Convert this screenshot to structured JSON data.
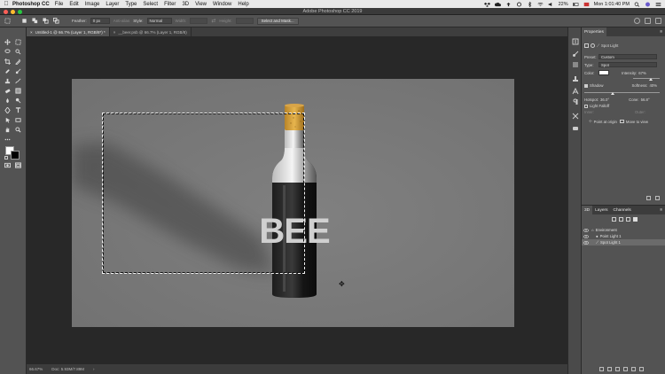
{
  "menubar": {
    "app": "Photoshop CC",
    "items": [
      "File",
      "Edit",
      "Image",
      "Layer",
      "Type",
      "Select",
      "Filter",
      "3D",
      "View",
      "Window",
      "Help"
    ],
    "battery": "22%",
    "clock": "Mon 1:01:40 PM"
  },
  "window": {
    "title": "Adobe Photoshop CC 2019"
  },
  "options": {
    "feather_label": "Feather:",
    "feather_value": "0 px",
    "antialias_label": "Anti-alias",
    "style_label": "Style:",
    "style_value": "Normal",
    "width_label": "Width:",
    "height_label": "Height:",
    "select_mask_label": "Select and Mask..."
  },
  "tabs": [
    {
      "label": "Untitled-1 @ 66.7% (Layer 1, RGB/8*) *"
    },
    {
      "label": "__beer.psb @ 66.7% (Layer 1, RGB/8)"
    }
  ],
  "status": {
    "zoom": "66.67%",
    "doc": "Doc: 5.93M/7.89M"
  },
  "properties": {
    "tab": "Properties",
    "light_type_title": "Spot Light",
    "preset_label": "Preset:",
    "preset_value": "Custom",
    "type_label": "Type:",
    "type_value": "Spot",
    "color_label": "Color:",
    "intensity_label": "Intensity:",
    "intensity_value": "67%",
    "shadow_label": "Shadow",
    "softness_label": "Softness:",
    "softness_value": "40%",
    "hotspot_label": "Hotspot:",
    "hotspot_value": "36.0°",
    "cone_label": "Cone:",
    "cone_value": "56.8°",
    "falloff_label": "Light Falloff",
    "inner_label": "Inner:",
    "outer_label": "Outer:",
    "point_origin": "Point at origin",
    "move_view": "Move to view",
    "light_color": "#ffffff"
  },
  "panel3d": {
    "tabs": [
      "3D",
      "Layers",
      "Channels"
    ],
    "rows": [
      {
        "label": "Environment"
      },
      {
        "label": "Point Light 1"
      },
      {
        "label": "Spot Light 1"
      }
    ]
  },
  "bottle": {
    "label_text": "BEE"
  }
}
